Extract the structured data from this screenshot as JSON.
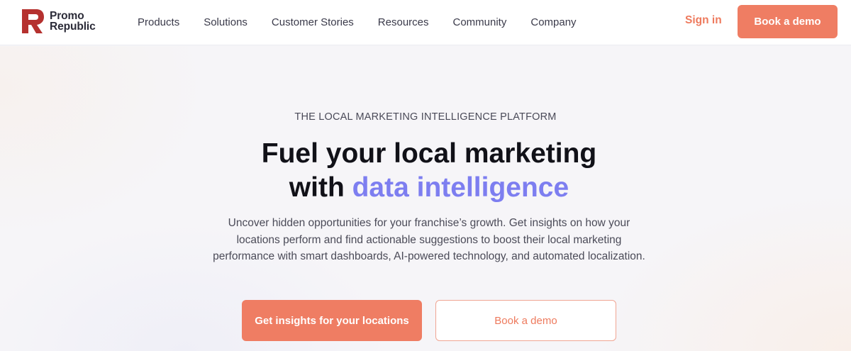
{
  "header": {
    "logo": {
      "line1": "Promo",
      "line2": "Republic"
    },
    "nav": [
      {
        "label": "Products"
      },
      {
        "label": "Solutions"
      },
      {
        "label": "Customer Stories"
      },
      {
        "label": "Resources"
      },
      {
        "label": "Community"
      },
      {
        "label": "Company"
      }
    ],
    "signin_label": "Sign in",
    "demo_label": "Book a demo"
  },
  "hero": {
    "eyebrow": "THE LOCAL MARKETING INTELLIGENCE PLATFORM",
    "headline_line1": "Fuel your local marketing",
    "headline_line2_prefix": "with ",
    "headline_line2_accent": "data intelligence",
    "description": "Uncover hidden opportunities for your franchise’s growth. Get insights on how your locations perform and find actionable suggestions to boost their local marketing performance with smart dashboards, AI-powered technology, and automated localization.",
    "primary_cta": "Get insights for your locations",
    "secondary_cta": "Book a demo"
  },
  "colors": {
    "brand": "#ef7d63",
    "accent": "#7d7ef0",
    "logo_red": "#b5312f"
  }
}
